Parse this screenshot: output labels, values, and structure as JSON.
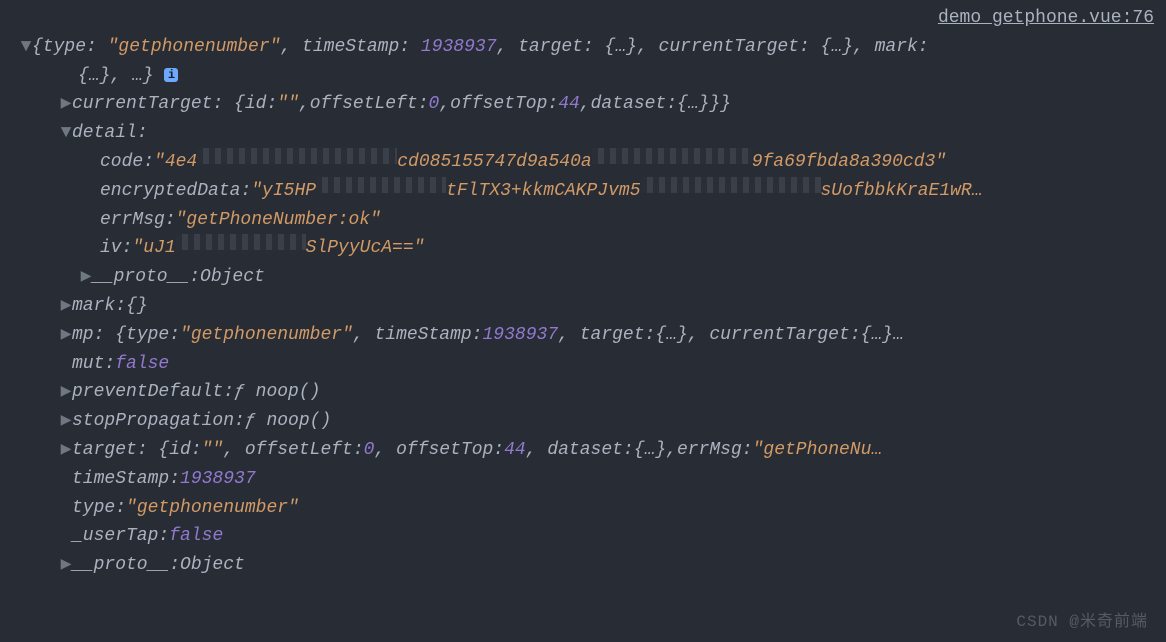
{
  "source": {
    "file": "demo_getphone.vue",
    "line": "76"
  },
  "summary": {
    "prefix": "{type: ",
    "type": "\"getphonenumber\"",
    "mid1": ", timeStamp: ",
    "ts": "1938937",
    "mid2": ", target: ",
    "target": "{…}",
    "mid3": ", currentTarget: ",
    "ct": "{…}",
    "mid4": ", mark: ",
    "mark": "{…}",
    "end": ", …}"
  },
  "currentTarget": {
    "label": "currentTarget",
    "id_key": "id",
    "id_val": "\"\"",
    "ol_key": "offsetLeft",
    "ol_val": "0",
    "ot_key": "offsetTop",
    "ot_val": "44",
    "ds_key": "dataset",
    "ds_val": "{…}"
  },
  "detail": {
    "label": "detail",
    "code_key": "code",
    "code_a": "\"4e4",
    "code_b": "cd085155747d9a540a",
    "code_c": "9fa69fbda8a390cd3\"",
    "enc_key": "encryptedData",
    "enc_a": "\"yI5HP",
    "enc_b": "tFlTX3+kkmCAKPJvm5",
    "enc_c": "sUofbbkKraE1wR…",
    "err_key": "errMsg",
    "err_val": "\"getPhoneNumber:ok\"",
    "iv_key": "iv",
    "iv_a": "\"uJ1",
    "iv_b": "SlPyyUcA==\"",
    "proto_key": "__proto__",
    "proto_val": "Object"
  },
  "mark": {
    "label": "mark",
    "val": "{}"
  },
  "mp": {
    "label": "mp",
    "type": "\"getphonenumber\"",
    "ts": "1938937",
    "target": "{…}",
    "ct": "{…}"
  },
  "mut": {
    "label": "mut",
    "val": "false"
  },
  "preventDefault": {
    "label": "preventDefault",
    "fn": "ƒ noop()"
  },
  "stopPropagation": {
    "label": "stopPropagation",
    "fn": "ƒ noop()"
  },
  "target": {
    "label": "target",
    "id_val": "\"\"",
    "ol_val": "0",
    "ot_val": "44",
    "ds_val": "{…}",
    "err_key": "errMsg",
    "err_val": "\"getPhoneNu…"
  },
  "timeStamp": {
    "label": "timeStamp",
    "val": "1938937"
  },
  "type": {
    "label": "type",
    "val": "\"getphonenumber\""
  },
  "userTap": {
    "label": "_userTap",
    "val": "false"
  },
  "proto": {
    "label": "__proto__",
    "val": "Object"
  },
  "watermark": "CSDN @米奇前端"
}
